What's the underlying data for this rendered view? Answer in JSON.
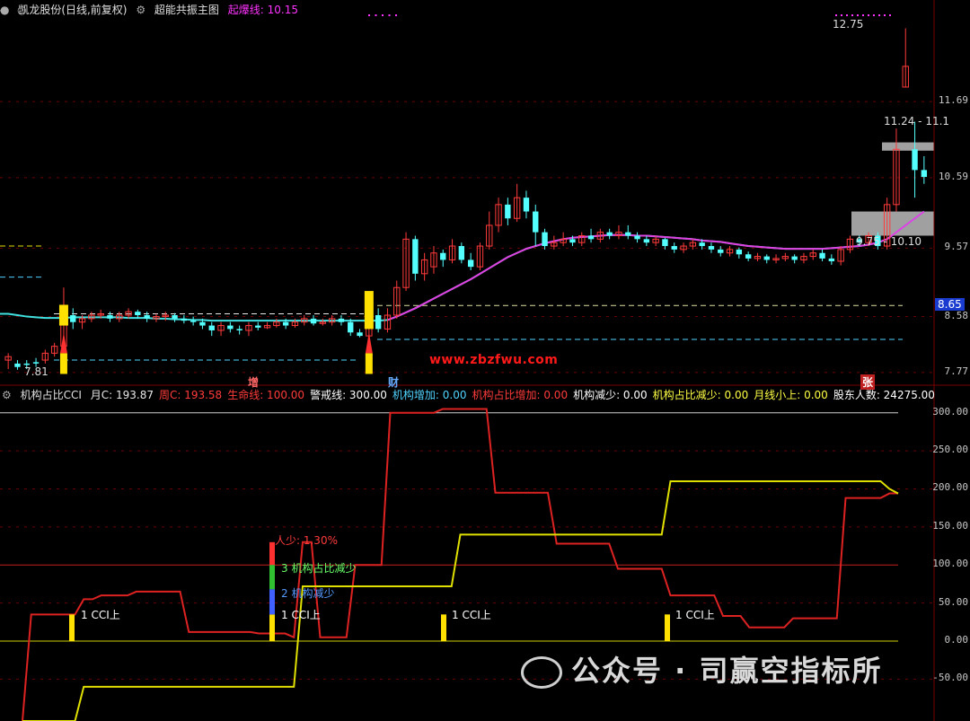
{
  "header_main": {
    "stock": "凯龙股份(日线,前复权)",
    "indicator": "超能共振主图",
    "start_line_label": "起爆线: 10.15"
  },
  "header_sub": {
    "name": "机构占比CCI",
    "items": [
      {
        "label": "月C: 193.87",
        "color": "#e8e8e8"
      },
      {
        "label": "周C: 193.58",
        "color": "#ff3b3b"
      },
      {
        "label": "生命线: 100.00",
        "color": "#ff3b3b"
      },
      {
        "label": "警戒线: 300.00",
        "color": "#ffffff"
      },
      {
        "label": "机构增加: 0.00",
        "color": "#4fd4ff"
      },
      {
        "label": "机构占比增加: 0.00",
        "color": "#ff3b3b"
      },
      {
        "label": "机构减少: 0.00",
        "color": "#ffffff"
      },
      {
        "label": "机构占比减少: 0.00",
        "color": "#ffff44"
      },
      {
        "label": "月线小上: 0.00",
        "color": "#ffff44"
      },
      {
        "label": "股东人数: 24275.00",
        "color": "#ffffff"
      }
    ]
  },
  "price_axis": [
    "11.69",
    "10.59",
    "9.57",
    "8.58",
    "7.77"
  ],
  "price_last": "8.65",
  "cci_axis": [
    "300.00",
    "250.00",
    "200.00",
    "150.00",
    "100.00",
    "50.00",
    "0.00",
    "-50.00"
  ],
  "annotations": {
    "high": "12.75",
    "low": "7.81",
    "zone_upper": "11.24 - 11.1",
    "zone_lower": "9.75 - 10.10",
    "mark_zeng": "增",
    "mark_cai": "财",
    "mark_zhang": "张",
    "cci_tags": [
      "1 CCI上",
      "1 CCI上",
      "1 CCI上",
      "1 CCI上"
    ],
    "tag_reduce_ratio": "3 机构占比减少",
    "tag_reduce": "2 机构减少",
    "tag_person": "人少: 1.30%"
  },
  "watermark": "www.zbzfwu.com",
  "wechat": "公众号 · 司赢空指标所",
  "chart_data": [
    {
      "type": "candlestick",
      "ylim": [
        7.6,
        12.9
      ],
      "candles": [
        [
          7.95,
          8.0,
          7.82,
          8.05
        ],
        [
          7.9,
          7.85,
          7.81,
          7.95
        ],
        [
          7.9,
          7.88,
          7.82,
          7.95
        ],
        [
          7.92,
          7.9,
          7.85,
          7.98
        ],
        [
          7.95,
          8.05,
          7.9,
          8.1
        ],
        [
          8.05,
          8.15,
          8.0,
          8.2
        ],
        [
          8.15,
          8.6,
          8.1,
          9.0
        ],
        [
          8.6,
          8.5,
          8.4,
          8.7
        ],
        [
          8.5,
          8.55,
          8.4,
          8.6
        ],
        [
          8.55,
          8.6,
          8.5,
          8.65
        ],
        [
          8.6,
          8.62,
          8.55,
          8.68
        ],
        [
          8.6,
          8.55,
          8.5,
          8.65
        ],
        [
          8.55,
          8.6,
          8.5,
          8.65
        ],
        [
          8.6,
          8.65,
          8.55,
          8.7
        ],
        [
          8.65,
          8.6,
          8.55,
          8.68
        ],
        [
          8.6,
          8.55,
          8.5,
          8.65
        ],
        [
          8.55,
          8.58,
          8.5,
          8.62
        ],
        [
          8.58,
          8.6,
          8.52,
          8.65
        ],
        [
          8.6,
          8.55,
          8.5,
          8.63
        ],
        [
          8.55,
          8.52,
          8.48,
          8.6
        ],
        [
          8.52,
          8.5,
          8.45,
          8.58
        ],
        [
          8.5,
          8.45,
          8.4,
          8.55
        ],
        [
          8.45,
          8.38,
          8.3,
          8.5
        ],
        [
          8.38,
          8.45,
          8.3,
          8.5
        ],
        [
          8.45,
          8.4,
          8.35,
          8.5
        ],
        [
          8.4,
          8.38,
          8.32,
          8.45
        ],
        [
          8.38,
          8.45,
          8.3,
          8.5
        ],
        [
          8.45,
          8.42,
          8.38,
          8.5
        ],
        [
          8.42,
          8.45,
          8.4,
          8.5
        ],
        [
          8.45,
          8.5,
          8.42,
          8.55
        ],
        [
          8.5,
          8.45,
          8.4,
          8.55
        ],
        [
          8.45,
          8.5,
          8.42,
          8.55
        ],
        [
          8.5,
          8.55,
          8.45,
          8.6
        ],
        [
          8.55,
          8.48,
          8.45,
          8.6
        ],
        [
          8.48,
          8.5,
          8.45,
          8.55
        ],
        [
          8.5,
          8.55,
          8.45,
          8.6
        ],
        [
          8.55,
          8.5,
          8.45,
          8.6
        ],
        [
          8.5,
          8.35,
          8.3,
          8.55
        ],
        [
          8.35,
          8.3,
          8.28,
          8.4
        ],
        [
          8.3,
          8.75,
          8.25,
          8.9
        ],
        [
          8.6,
          8.4,
          8.35,
          8.7
        ],
        [
          8.4,
          8.6,
          8.35,
          8.7
        ],
        [
          8.6,
          9.0,
          8.55,
          9.1
        ],
        [
          9.0,
          9.7,
          8.95,
          9.8
        ],
        [
          9.7,
          9.2,
          9.1,
          9.75
        ],
        [
          9.2,
          9.4,
          9.1,
          9.5
        ],
        [
          9.3,
          9.5,
          9.2,
          9.6
        ],
        [
          9.5,
          9.4,
          9.3,
          9.55
        ],
        [
          9.4,
          9.6,
          9.35,
          9.7
        ],
        [
          9.6,
          9.4,
          9.35,
          9.65
        ],
        [
          9.4,
          9.3,
          9.25,
          9.5
        ],
        [
          9.3,
          9.6,
          9.25,
          9.65
        ],
        [
          9.6,
          9.9,
          9.55,
          10.1
        ],
        [
          9.9,
          10.2,
          9.8,
          10.3
        ],
        [
          10.2,
          10.0,
          9.9,
          10.3
        ],
        [
          10.0,
          10.3,
          9.95,
          10.5
        ],
        [
          10.3,
          10.1,
          10.0,
          10.4
        ],
        [
          10.1,
          9.8,
          9.6,
          10.2
        ],
        [
          9.8,
          9.6,
          9.55,
          9.85
        ],
        [
          9.6,
          9.65,
          9.55,
          9.75
        ],
        [
          9.65,
          9.7,
          9.6,
          9.8
        ],
        [
          9.7,
          9.65,
          9.6,
          9.75
        ],
        [
          9.65,
          9.75,
          9.6,
          9.8
        ],
        [
          9.75,
          9.7,
          9.65,
          9.85
        ],
        [
          9.7,
          9.8,
          9.65,
          9.85
        ],
        [
          9.8,
          9.75,
          9.7,
          9.85
        ],
        [
          9.75,
          9.8,
          9.7,
          9.9
        ],
        [
          9.8,
          9.75,
          9.7,
          9.9
        ],
        [
          9.75,
          9.7,
          9.65,
          9.8
        ],
        [
          9.7,
          9.65,
          9.6,
          9.75
        ],
        [
          9.65,
          9.7,
          9.6,
          9.75
        ],
        [
          9.7,
          9.6,
          9.55,
          9.72
        ],
        [
          9.6,
          9.55,
          9.5,
          9.65
        ],
        [
          9.55,
          9.6,
          9.5,
          9.65
        ],
        [
          9.6,
          9.65,
          9.55,
          9.7
        ],
        [
          9.65,
          9.6,
          9.55,
          9.7
        ],
        [
          9.6,
          9.55,
          9.5,
          9.65
        ],
        [
          9.55,
          9.5,
          9.45,
          9.6
        ],
        [
          9.5,
          9.55,
          9.45,
          9.6
        ],
        [
          9.55,
          9.48,
          9.42,
          9.58
        ],
        [
          9.48,
          9.42,
          9.38,
          9.52
        ],
        [
          9.42,
          9.45,
          9.38,
          9.5
        ],
        [
          9.45,
          9.4,
          9.35,
          9.48
        ],
        [
          9.4,
          9.42,
          9.35,
          9.48
        ],
        [
          9.42,
          9.45,
          9.38,
          9.5
        ],
        [
          9.45,
          9.4,
          9.35,
          9.48
        ],
        [
          9.4,
          9.45,
          9.35,
          9.5
        ],
        [
          9.45,
          9.5,
          9.4,
          9.55
        ],
        [
          9.5,
          9.42,
          9.38,
          9.55
        ],
        [
          9.42,
          9.38,
          9.33,
          9.48
        ],
        [
          9.38,
          9.55,
          9.32,
          9.6
        ],
        [
          9.55,
          9.7,
          9.5,
          9.75
        ],
        [
          9.7,
          9.65,
          9.6,
          9.75
        ],
        [
          9.65,
          9.75,
          9.6,
          9.8
        ],
        [
          9.75,
          9.6,
          9.55,
          9.8
        ],
        [
          9.6,
          10.2,
          9.55,
          10.3
        ],
        [
          10.2,
          11.0,
          10.1,
          11.3
        ],
        [
          11.9,
          12.2,
          11.9,
          12.75
        ],
        [
          11.0,
          10.7,
          10.3,
          11.4
        ],
        [
          10.7,
          10.6,
          10.5,
          10.9
        ]
      ],
      "ma_cyan": [
        8.62,
        8.6,
        8.58,
        8.57,
        8.56,
        8.56,
        8.56,
        8.57,
        8.57,
        8.57,
        8.57,
        8.57,
        8.57,
        8.56,
        8.56,
        8.56,
        8.55,
        8.55,
        8.54,
        8.54,
        8.53,
        8.53,
        8.52,
        8.52,
        8.52,
        8.52,
        8.52,
        8.52,
        8.52,
        8.52,
        8.52,
        8.52,
        8.52,
        8.52,
        8.52,
        8.52,
        8.52,
        8.52,
        8.52,
        8.52,
        8.52,
        8.53,
        8.58,
        8.64,
        8.7,
        8.77,
        8.84,
        8.91,
        8.98,
        9.05,
        9.12,
        9.2,
        9.28,
        9.36,
        9.44,
        9.5,
        9.56,
        9.6,
        9.64,
        9.67,
        9.7,
        9.72,
        9.73,
        9.74,
        9.75,
        9.76,
        9.76,
        9.76,
        9.75,
        9.75,
        9.74,
        9.73,
        9.72,
        9.71,
        9.7,
        9.68,
        9.67,
        9.66,
        9.64,
        9.62,
        9.6,
        9.59,
        9.58,
        9.57,
        9.56,
        9.56,
        9.56,
        9.56,
        9.56,
        9.57,
        9.58,
        9.59,
        9.6,
        9.62,
        9.65,
        9.7,
        9.8,
        9.9,
        10.0,
        10.1
      ],
      "ma_magenta_start": 41
    },
    {
      "type": "line",
      "ylim": [
        -105,
        315
      ],
      "series": [
        {
          "color": "#dd2222",
          "values": [
            -105,
            35,
            35,
            35,
            35,
            35,
            35,
            55,
            55,
            60,
            60,
            60,
            60,
            65,
            65,
            65,
            65,
            65,
            65,
            12,
            12,
            12,
            12,
            12,
            12,
            12,
            12,
            10,
            10,
            10,
            10,
            5,
            130,
            130,
            5,
            5,
            5,
            5,
            100,
            100,
            100,
            100,
            300,
            300,
            300,
            300,
            300,
            300,
            305,
            305,
            305,
            305,
            305,
            305,
            195,
            195,
            195,
            195,
            195,
            195,
            195,
            128,
            128,
            128,
            128,
            128,
            128,
            128,
            95,
            95,
            95,
            95,
            95,
            95,
            60,
            60,
            60,
            60,
            60,
            60,
            33,
            33,
            33,
            18,
            18,
            18,
            18,
            18,
            30,
            30,
            30,
            30,
            30,
            30,
            188,
            188,
            188,
            188,
            188,
            194,
            194
          ]
        },
        {
          "color": "#e0e000",
          "values": [
            -105,
            -105,
            -105,
            -105,
            -105,
            -105,
            -105,
            -60,
            -60,
            -60,
            -60,
            -60,
            -60,
            -60,
            -60,
            -60,
            -60,
            -60,
            -60,
            -60,
            -60,
            -60,
            -60,
            -60,
            -60,
            -60,
            -60,
            -60,
            -60,
            -60,
            -60,
            -60,
            72,
            72,
            72,
            72,
            72,
            72,
            72,
            72,
            72,
            72,
            72,
            72,
            72,
            72,
            72,
            72,
            72,
            72,
            140,
            140,
            140,
            140,
            140,
            140,
            140,
            140,
            140,
            140,
            140,
            140,
            140,
            140,
            140,
            140,
            140,
            140,
            140,
            140,
            140,
            140,
            140,
            140,
            210,
            210,
            210,
            210,
            210,
            210,
            210,
            210,
            210,
            210,
            210,
            210,
            210,
            210,
            210,
            210,
            210,
            210,
            210,
            210,
            210,
            210,
            210,
            210,
            210,
            200,
            194
          ]
        }
      ]
    }
  ]
}
